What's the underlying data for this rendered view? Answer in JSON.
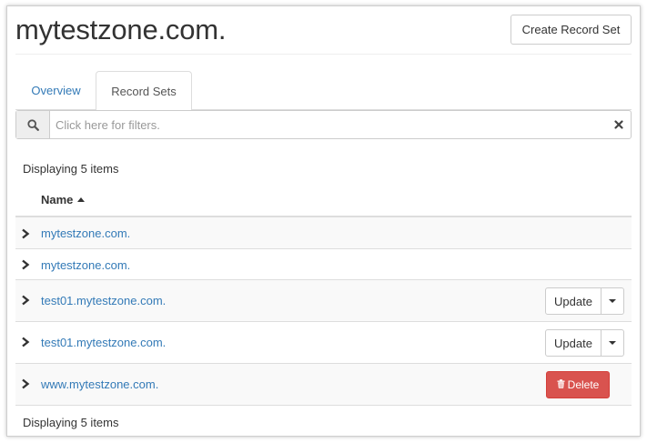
{
  "header": {
    "title": "mytestzone.com.",
    "create_button": "Create Record Set"
  },
  "tabs": [
    {
      "label": "Overview",
      "active": false
    },
    {
      "label": "Record Sets",
      "active": true
    }
  ],
  "filter": {
    "placeholder": "Click here for filters.",
    "value": "",
    "icons": {
      "search": "search-icon",
      "clear": "close-icon"
    }
  },
  "table": {
    "count_top": "Displaying 5 items",
    "count_bottom": "Displaying 5 items",
    "columns": [
      {
        "label": "Name",
        "sort": "ascending"
      }
    ],
    "rows": [
      {
        "name": "mytestzone.com.",
        "action": null
      },
      {
        "name": "mytestzone.com.",
        "action": null
      },
      {
        "name": "test01.mytestzone.com.",
        "action": "Update"
      },
      {
        "name": "test01.mytestzone.com.",
        "action": "Update"
      },
      {
        "name": "www.mytestzone.com.",
        "action": "Delete"
      }
    ]
  },
  "colors": {
    "link": "#337ab7",
    "danger": "#d9534f",
    "border": "#dddddd",
    "stripe": "#f9f9f9"
  }
}
